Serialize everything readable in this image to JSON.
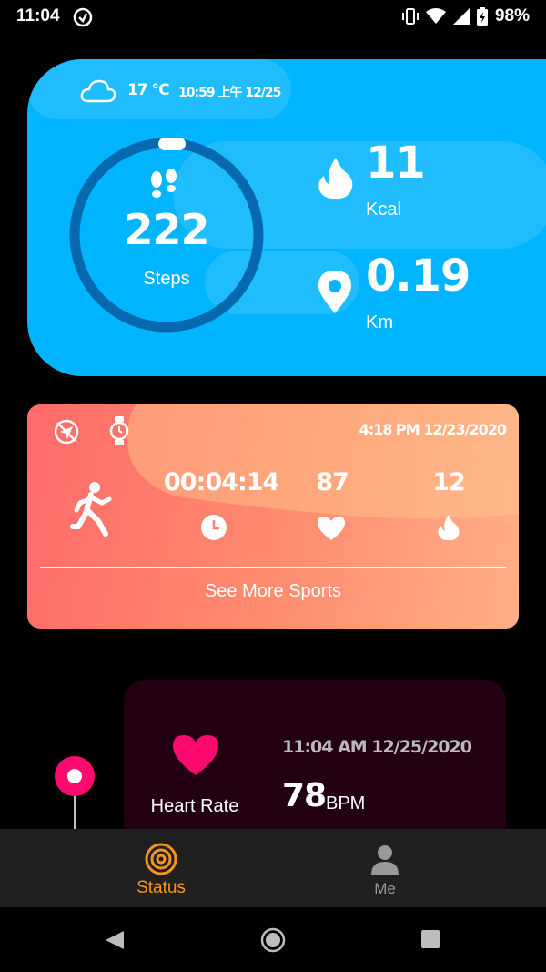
{
  "status_bar": {
    "time": "11:04",
    "battery": "98%"
  },
  "weather": {
    "temp": "17 °C",
    "datetime": "10:59 上午 12/25"
  },
  "steps": {
    "value": "222",
    "label": "Steps"
  },
  "calories": {
    "value": "11",
    "unit": "Kcal"
  },
  "distance": {
    "value": "0.19",
    "unit": "Km"
  },
  "sport": {
    "datetime": "4:18 PM 12/23/2020",
    "duration": "00:04:14",
    "heart": "87",
    "calories": "12",
    "see_more": "See More Sports"
  },
  "heart_rate": {
    "label": "Heart Rate",
    "datetime": "11:04 AM 12/25/2020",
    "value": "78",
    "unit": "BPM"
  },
  "nav": {
    "status_label": "Status",
    "me_label": "Me"
  },
  "colors": {
    "accent": "#f7931e",
    "blue": "#00b4fe",
    "heart": "#ff0a6e"
  }
}
